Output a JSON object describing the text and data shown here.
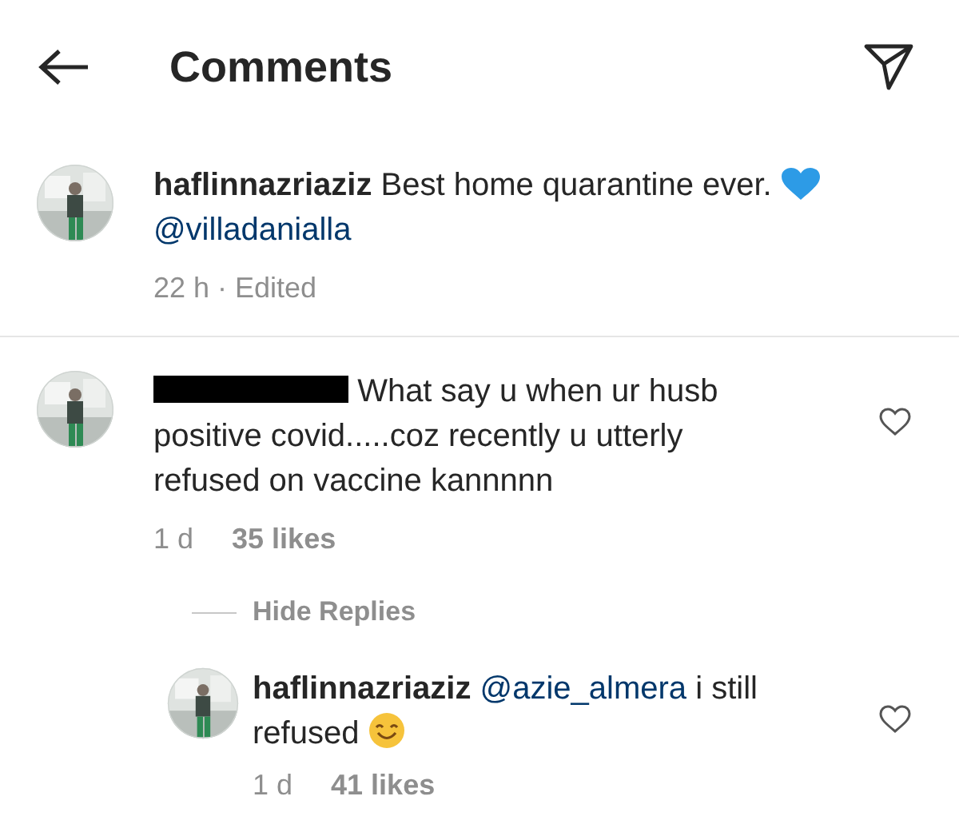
{
  "header": {
    "title": "Comments"
  },
  "caption": {
    "username": "haflinnazriaziz",
    "text": "Best home quarantine ever.",
    "mention": "@villadanialla",
    "time": "22 h · Edited"
  },
  "comments": [
    {
      "username_redacted": true,
      "text": "What say u when ur husb positive covid.....coz recently u utterly refused on vaccine kannnnn",
      "time": "1 d",
      "likes": "35 likes",
      "liked": false,
      "replies_toggle": "Hide Replies",
      "replies": [
        {
          "username": "haflinnazriaziz",
          "mention": "@azie_almera",
          "text_lines": [
            "i still",
            "refused"
          ],
          "time": "1 d",
          "likes": "41 likes",
          "liked": false
        }
      ]
    }
  ]
}
